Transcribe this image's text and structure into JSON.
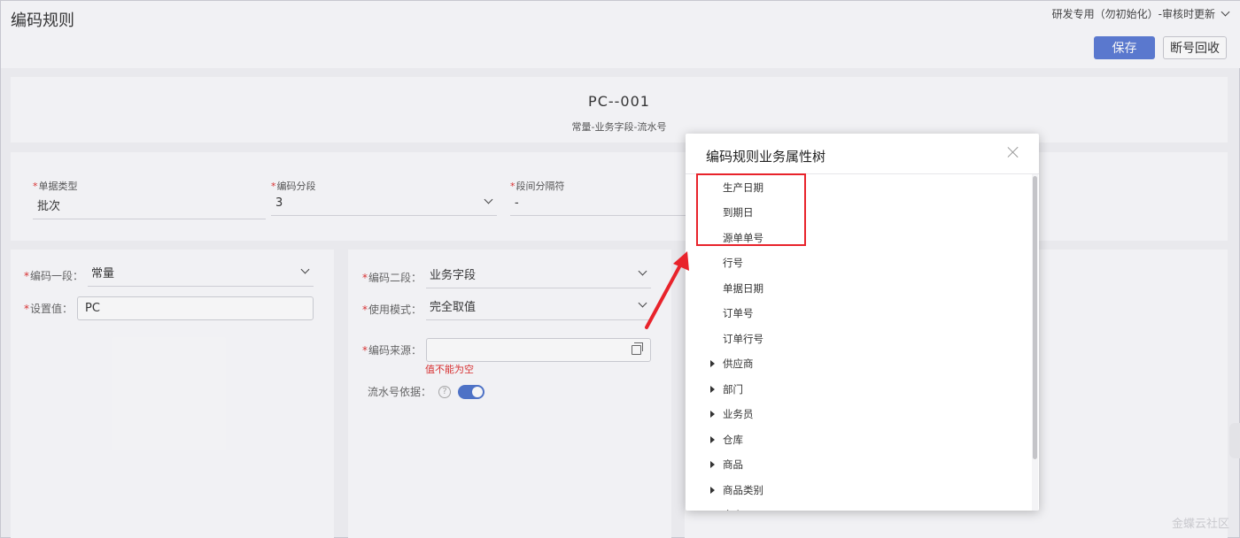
{
  "header": {
    "title": "编码规则",
    "org": "研发专用（勿初始化）-审核时更新",
    "save": "保存",
    "recycle": "断号回收"
  },
  "preview": {
    "code": "PC--001",
    "desc": "常量-业务字段-流水号"
  },
  "basic": {
    "doc_type_label": "单据类型",
    "doc_type_value": "批次",
    "segments_label": "编码分段",
    "segments_value": "3",
    "separator_label": "段间分隔符",
    "separator_value": "-"
  },
  "segment1": {
    "seg_label": "编码一段：",
    "seg_value": "常量",
    "set_label": "设置值：",
    "set_value": "PC"
  },
  "segment2": {
    "seg_label": "编码二段：",
    "seg_value": "业务字段",
    "mode_label": "使用模式：",
    "mode_value": "完全取值",
    "source_label": "编码来源：",
    "source_value": "",
    "error": "值不能为空",
    "serial_label": "流水号依据：",
    "help": "?"
  },
  "modal": {
    "title": "编码规则业务属性树",
    "items": [
      {
        "label": "生产日期",
        "expandable": false
      },
      {
        "label": "到期日",
        "expandable": false
      },
      {
        "label": "源单单号",
        "expandable": false
      },
      {
        "label": "行号",
        "expandable": false
      },
      {
        "label": "单据日期",
        "expandable": false
      },
      {
        "label": "订单号",
        "expandable": false
      },
      {
        "label": "订单行号",
        "expandable": false
      },
      {
        "label": "供应商",
        "expandable": true
      },
      {
        "label": "部门",
        "expandable": true
      },
      {
        "label": "业务员",
        "expandable": true
      },
      {
        "label": "仓库",
        "expandable": true
      },
      {
        "label": "商品",
        "expandable": true
      },
      {
        "label": "商品类别",
        "expandable": true
      },
      {
        "label": "客户",
        "expandable": true
      }
    ]
  },
  "watermark": "金蝶云社区",
  "colors": {
    "primary": "#5b7bd5",
    "error": "#e03030",
    "highlight": "#e8232b"
  }
}
